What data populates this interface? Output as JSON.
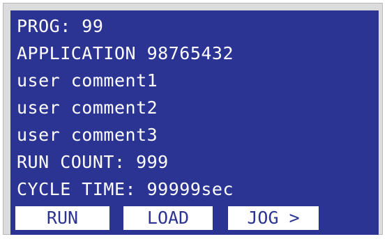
{
  "display": {
    "lines": [
      "PROG: 99",
      "APPLICATION 98765432",
      "user comment1",
      "user comment2",
      "user comment3",
      "RUN COUNT: 999",
      "CYCLE TIME: 99999sec"
    ],
    "softkeys": {
      "run": "RUN",
      "load": "LOAD",
      "jog": "JOG >"
    },
    "colors": {
      "screen_background": "#2b3492",
      "text": "#ffffff",
      "softkey_background": "#ffffff",
      "softkey_text": "#2b3492"
    }
  }
}
